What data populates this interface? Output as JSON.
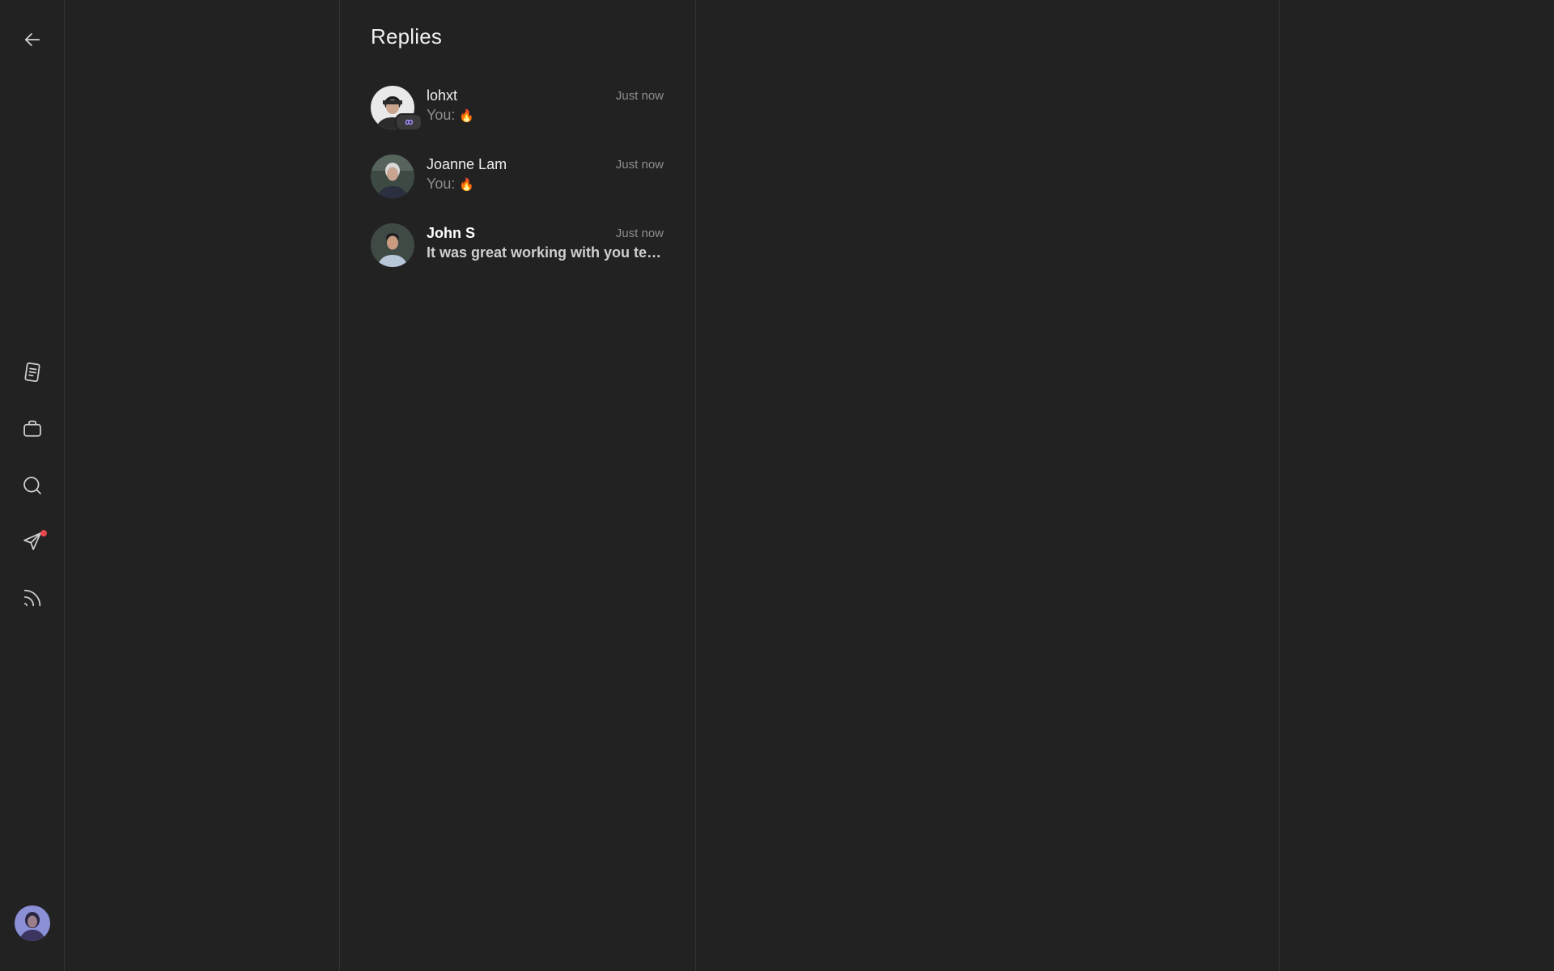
{
  "nav": {
    "back": {
      "icon": "arrow-left-icon"
    },
    "items": [
      {
        "icon": "document-icon"
      },
      {
        "icon": "briefcase-icon"
      },
      {
        "icon": "search-icon"
      },
      {
        "icon": "send-icon",
        "has_notification": true
      },
      {
        "icon": "feed-icon"
      }
    ],
    "profile": {
      "icon": "profile-avatar"
    }
  },
  "replies": {
    "title": "Replies",
    "conversations": [
      {
        "name": "lohxt",
        "time": "Just now",
        "preview_prefix": "You: ",
        "preview_emoji": "🔥",
        "unread": false
      },
      {
        "name": "Joanne Lam",
        "time": "Just now",
        "preview_prefix": "You: ",
        "preview_emoji": "🔥",
        "unread": false
      },
      {
        "name": "John S",
        "time": "Just now",
        "preview_text": "It was great working with you team",
        "unread": true
      }
    ]
  },
  "colors": {
    "background": "#222222",
    "divider": "#353535",
    "notification": "#e5484d",
    "text_primary": "#eeeeee",
    "text_secondary": "#8e8e8e"
  }
}
